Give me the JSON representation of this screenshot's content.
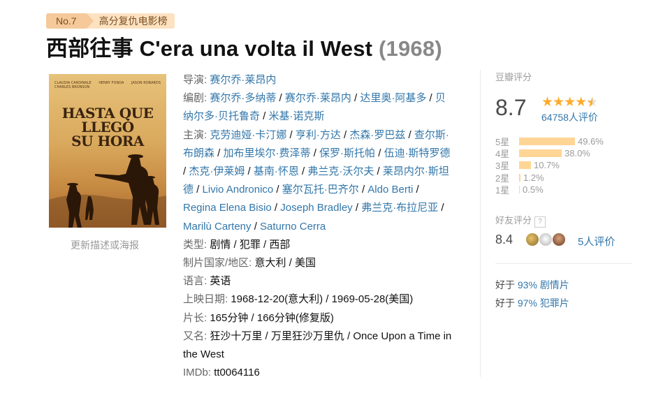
{
  "ranking": {
    "no": "No.7",
    "name": "高分复仇电影榜"
  },
  "title": {
    "cn": "西部往事",
    "orig": "C'era una volta il West",
    "year": "(1968)"
  },
  "poster": {
    "credits": [
      "CLAUDIA CARDINALE",
      "HENRY FONDA",
      "JASON ROBARDS",
      "CHARLES BRONSON"
    ],
    "title_lines": [
      "HASTA QUE",
      "LLEGÓ",
      "SU HORA"
    ],
    "update_link": "更新描述或海报"
  },
  "info": {
    "director_label": "导演",
    "directors": [
      "赛尔乔·莱昂内"
    ],
    "writer_label": "编剧",
    "writers_line1": [
      "赛尔乔·多纳蒂",
      "赛尔乔·莱昂内",
      "达里奥·阿基多",
      "贝"
    ],
    "writers_line2": [
      "纳尔多·贝托鲁奇",
      "米基·诺克斯"
    ],
    "cast_label": "主演",
    "cast_lines": [
      [
        "克劳迪娅·卡汀娜",
        "亨利·方达",
        "杰森·罗巴兹",
        "查尔斯·"
      ],
      [
        "布朗森",
        "加布里埃尔·费泽蒂",
        "保罗·斯托帕",
        "伍迪·斯特罗德"
      ],
      [
        "杰克·伊莱姆",
        "基南·怀恩",
        "弗兰克·沃尔夫",
        "莱昂内尔·斯坦"
      ],
      [
        "德",
        "Livio Andronico",
        "塞尔瓦托·巴齐尔",
        "Aldo Berti"
      ],
      [
        "Regina Elena Bisio",
        "Joseph Bradley",
        "弗兰克·布拉尼亚"
      ],
      [
        "Marilù Carteny",
        "Saturno Cerra"
      ]
    ],
    "genre_label": "类型:",
    "genres": "剧情 / 犯罪 / 西部",
    "country_label": "制片国家/地区:",
    "country": "意大利 / 美国",
    "language_label": "语言:",
    "language": "英语",
    "release_label": "上映日期:",
    "release": "1968-12-20(意大利) / 1969-05-28(美国)",
    "runtime_label": "片长:",
    "runtime": "165分钟 / 166分钟(修复版)",
    "aka_label": "又名:",
    "aka_line1": "狂沙十万里 / 万里狂沙万里仇 / Once Upon a Time in",
    "aka_line2": "the West",
    "imdb_label": "IMDb:",
    "imdb": "tt0064116"
  },
  "rating": {
    "label": "豆瓣评分",
    "score": "8.7",
    "stars": 4.5,
    "count": "64758人评价",
    "breakdown": [
      {
        "label": "5星",
        "pct": "49.6%",
        "value": 49.6
      },
      {
        "label": "4星",
        "pct": "38.0%",
        "value": 38.0
      },
      {
        "label": "3星",
        "pct": "10.7%",
        "value": 10.7
      },
      {
        "label": "2星",
        "pct": "1.2%",
        "value": 1.2
      },
      {
        "label": "1星",
        "pct": "0.5%",
        "value": 0.5
      }
    ],
    "friend_label": "好友评分",
    "friend_help": "?",
    "friend_score": "8.4",
    "friend_count": "5人评价",
    "better_than": [
      {
        "prefix": "好于",
        "pct": "93%",
        "genre": "剧情片"
      },
      {
        "prefix": "好于",
        "pct": "97%",
        "genre": "犯罪片"
      }
    ]
  }
}
